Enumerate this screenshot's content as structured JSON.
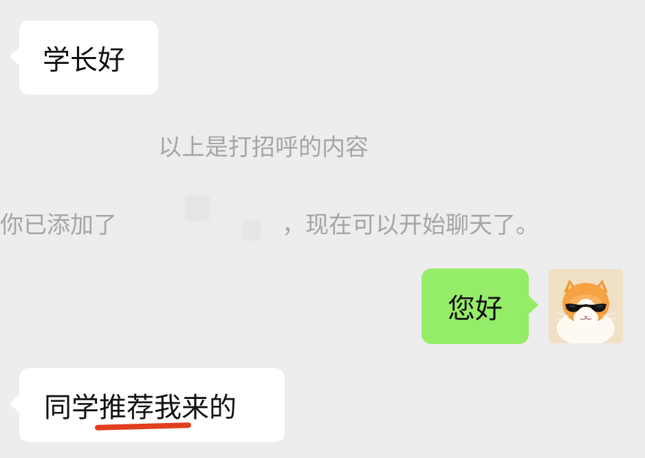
{
  "messages": [
    {
      "side": "left",
      "text": "学长好"
    },
    {
      "side": "right",
      "text": "您好"
    },
    {
      "side": "left",
      "text": "同学推荐我来的"
    }
  ],
  "system_notices": {
    "greeting_notice": "以上是打招呼的内容",
    "added_prefix": "你已添加了",
    "added_suffix": "，现在可以开始聊天了。"
  },
  "avatar": {
    "icon": "cat-with-sunglasses-avatar-icon"
  },
  "colors": {
    "background": "#ededed",
    "left_bubble": "#ffffff",
    "right_bubble": "#95ec69",
    "system_text": "#a5a5a5",
    "underline_mark": "#e13f1e"
  }
}
